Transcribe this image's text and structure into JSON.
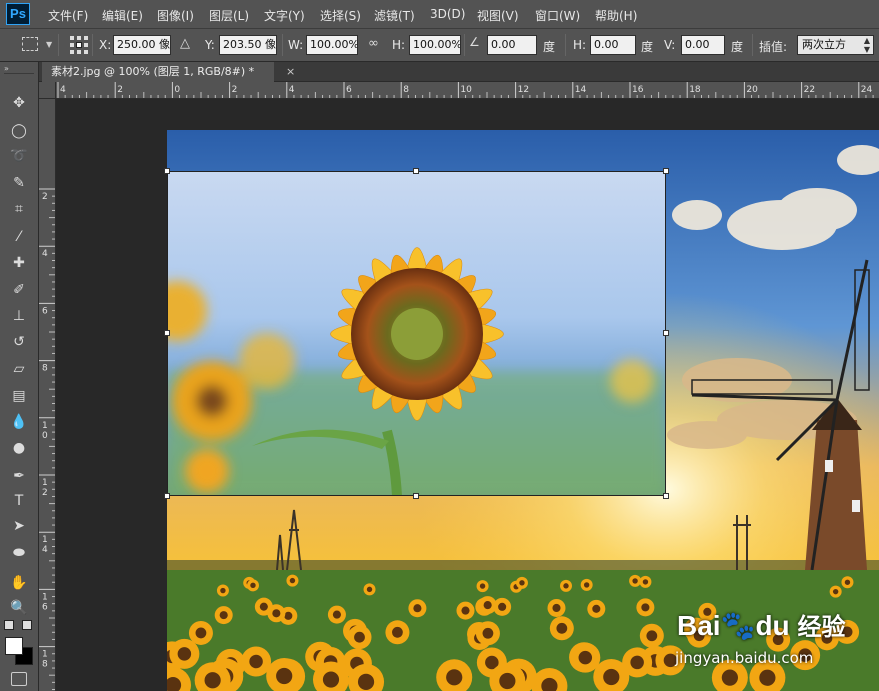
{
  "app": {
    "logo": "Ps"
  },
  "menus": [
    "文件(F)",
    "编辑(E)",
    "图像(I)",
    "图层(L)",
    "文字(Y)",
    "选择(S)",
    "滤镜(T)",
    "3D(D)",
    "视图(V)",
    "窗口(W)",
    "帮助(H)"
  ],
  "options": {
    "x_label": "X:",
    "x_value": "250.00 像",
    "y_label": "Y:",
    "y_value": "203.50 像",
    "w_label": "W:",
    "w_value": "100.00%",
    "h_label": "H:",
    "h_value": "100.00%",
    "angle_value": "0.00",
    "angle_unit": "度",
    "hskew_label": "H:",
    "hskew_value": "0.00",
    "hskew_unit": "度",
    "vskew_label": "V:",
    "vskew_value": "0.00",
    "vskew_unit": "度",
    "interp_label": "插值:",
    "interp_value": "两次立方"
  },
  "document": {
    "tab_title": "素材2.jpg @ 100% (图层 1, RGB/8#) *",
    "close": "×"
  },
  "rulers": {
    "horizontal": [
      "4",
      "2",
      "0",
      "2",
      "4",
      "6",
      "8",
      "10",
      "12",
      "14",
      "16",
      "18",
      "20",
      "22",
      "24"
    ],
    "vertical": [
      "2",
      "4",
      "6",
      "8",
      "10",
      "12",
      "14",
      "16",
      "18"
    ]
  },
  "tools": [
    "move-icon",
    "ellipse-marquee-icon",
    "lasso-icon",
    "quick-select-icon",
    "crop-icon",
    "eyedropper-icon",
    "healing-brush-icon",
    "brush-icon",
    "clone-stamp-icon",
    "history-brush-icon",
    "eraser-icon",
    "gradient-icon",
    "blur-icon",
    "dodge-icon",
    "pen-icon",
    "type-icon",
    "path-select-icon",
    "ellipse-shape-icon",
    "hand-icon",
    "zoom-icon"
  ],
  "watermark": {
    "brand": "Bai",
    "brand2": "du",
    "cn": "经验",
    "url": "jingyan.baidu.com"
  }
}
